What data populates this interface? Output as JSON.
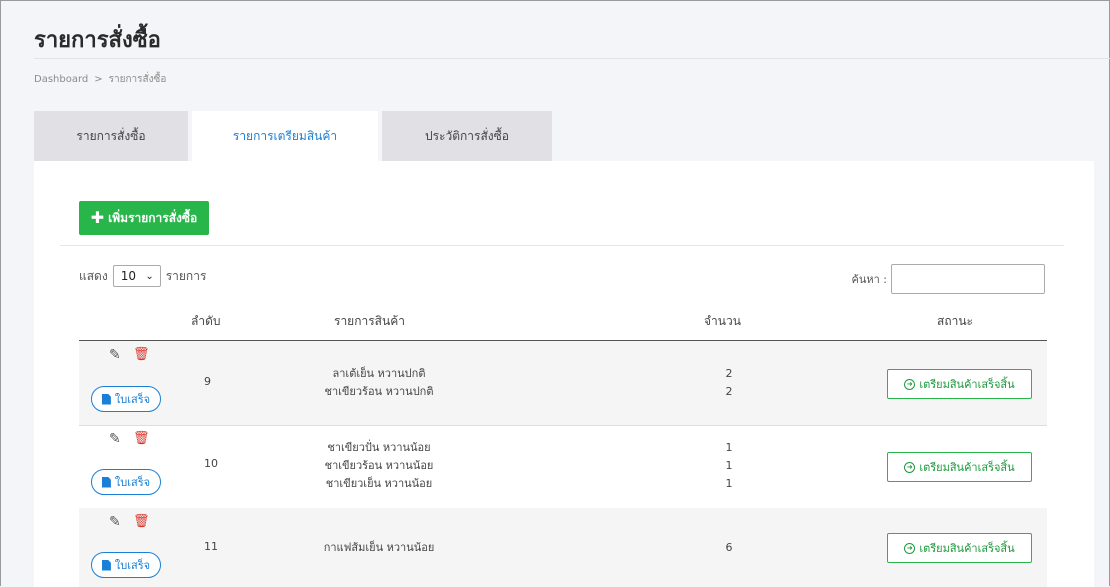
{
  "page": {
    "title": "รายการสั่งซื้อ"
  },
  "breadcrumb": {
    "home": "Dashboard",
    "separator": ">",
    "current": "รายการสั่งซื้อ"
  },
  "tabs": [
    {
      "label": "รายการสั่งซื้อ",
      "active": false
    },
    {
      "label": "รายการเตรียมสินค้า",
      "active": true
    },
    {
      "label": "ประวัติการสั่งซื้อ",
      "active": false
    }
  ],
  "toolbar": {
    "add_label": "เพิ่มรายการสั่งซื้อ",
    "add_icon": "plus-icon"
  },
  "length": {
    "prefix": "แสดง",
    "value": "10",
    "suffix": "รายการ"
  },
  "search": {
    "label": "ค้นหา :",
    "value": ""
  },
  "table": {
    "headers": {
      "no": "ลำดับ",
      "items": "รายการสินค้า",
      "qty": "จำนวน",
      "status": "สถานะ"
    },
    "rows": [
      {
        "no": "9",
        "items": [
          "ลาเต้เย็น หวานปกติ",
          "ชาเขียวร้อน หวานปกติ"
        ],
        "qty": [
          "2",
          "2"
        ],
        "receipt_label": "ใบเสร็จ",
        "status_label": "เตรียมสินค้าเสร็จสิ้น"
      },
      {
        "no": "10",
        "items": [
          "ชาเขียวปั่น หวานน้อย",
          "ชาเขียวร้อน หวานน้อย",
          "ชาเขียวเย็น หวานน้อย"
        ],
        "qty": [
          "1",
          "1",
          "1"
        ],
        "receipt_label": "ใบเสร็จ",
        "status_label": "เตรียมสินค้าเสร็จสิ้น"
      },
      {
        "no": "11",
        "items": [
          "กาแฟส้มเย็น หวานน้อย"
        ],
        "qty": [
          "6"
        ],
        "receipt_label": "ใบเสร็จ",
        "status_label": "เตรียมสินค้าเสร็จสิ้น"
      }
    ]
  },
  "colors": {
    "primary": "#1a7fd6",
    "success": "#28b54a",
    "danger": "#d9342b"
  }
}
